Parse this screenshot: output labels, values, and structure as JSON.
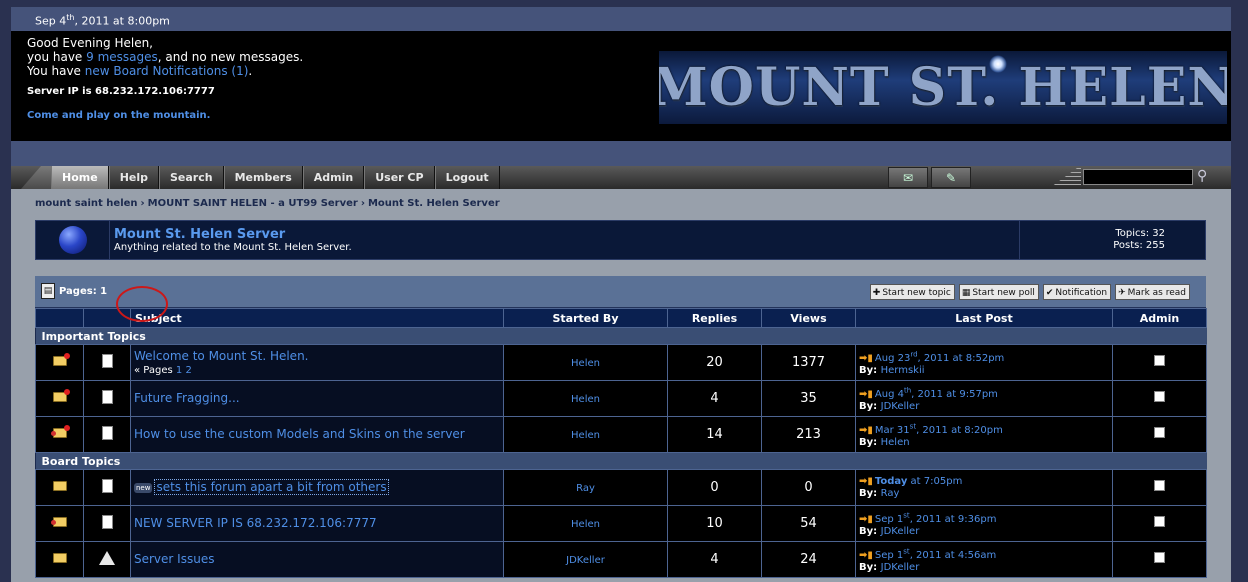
{
  "topbar": {
    "date_pre": "Sep 4",
    "date_sup": "th",
    "date_post": ", 2011 at 8:00pm"
  },
  "header": {
    "greeting": "Good Evening Helen,",
    "msg_pre": "you have ",
    "msg_link": "9 messages",
    "msg_post": ", and no new messages.",
    "notif_pre": "You have ",
    "notif_link": "new Board Notifications (1)",
    "notif_post": ".",
    "server_ip": "Server IP is 68.232.172.106:7777",
    "play": "Come and play on the mountain.",
    "logo_text": "MOUNT ST. HELEN"
  },
  "nav": {
    "items": [
      "Home",
      "Help",
      "Search",
      "Members",
      "Admin",
      "User CP",
      "Logout"
    ],
    "search_value": ""
  },
  "breadcrumb": [
    "mount saint helen",
    "MOUNT SAINT HELEN - a UT99 Server",
    "Mount St. Helen Server"
  ],
  "board": {
    "title": "Mount St. Helen Server",
    "desc": "Anything related to the Mount St. Helen Server.",
    "topics": "Topics: 32",
    "posts": "Posts: 255"
  },
  "toolbar": {
    "pages": "Pages: 1",
    "start_topic": "Start new topic",
    "start_poll": "Start new poll",
    "notification": "Notification",
    "mark_read": "Mark as read"
  },
  "columns": [
    "Subject",
    "Started By",
    "Replies",
    "Views",
    "Last Post",
    "Admin"
  ],
  "sections": {
    "important": "Important Topics",
    "board": "Board Topics"
  },
  "topics": [
    {
      "title": "Welcome to Mount St. Helen.",
      "pages_prefix": "« Pages",
      "pages": [
        "1",
        "2"
      ],
      "starter": "Helen",
      "replies": "20",
      "views": "1377",
      "last_pre": "Aug 23",
      "last_sup": "rd",
      "last_post": ", 2011 at 8:52pm",
      "by_label": "By:",
      "by": "Hermskii"
    },
    {
      "title": "Future Fragging...",
      "starter": "Helen",
      "replies": "4",
      "views": "35",
      "last_pre": "Aug 4",
      "last_sup": "th",
      "last_post": ", 2011 at 9:57pm",
      "by_label": "By:",
      "by": "JDKeller"
    },
    {
      "title": "How to use the custom Models and Skins on the server",
      "starter": "Helen",
      "replies": "14",
      "views": "213",
      "last_pre": "Mar 31",
      "last_sup": "st",
      "last_post": ", 2011 at 8:20pm",
      "by_label": "By:",
      "by": "Helen"
    },
    {
      "title": "sets this forum apart a bit from others",
      "badge": "new",
      "starter": "Ray",
      "replies": "0",
      "views": "0",
      "last_today": "Today",
      "last_post": " at 7:05pm",
      "by_label": "By:",
      "by": "Ray"
    },
    {
      "title": "NEW SERVER IP IS 68.232.172.106:7777",
      "starter": "Helen",
      "replies": "10",
      "views": "54",
      "last_pre": "Sep 1",
      "last_sup": "st",
      "last_post": ", 2011 at 9:36pm",
      "by_label": "By:",
      "by": "JDKeller"
    },
    {
      "title": "Server Issues",
      "starter": "JDKeller",
      "replies": "4",
      "views": "24",
      "last_pre": "Sep 1",
      "last_sup": "st",
      "last_post": ", 2011 at 4:56am",
      "by_label": "By:",
      "by": "JDKeller"
    }
  ],
  "colors": {
    "accent": "#4f8fe6",
    "header_bg": "#000000",
    "table_head": "#0a2050",
    "section": "#3a4e74"
  }
}
